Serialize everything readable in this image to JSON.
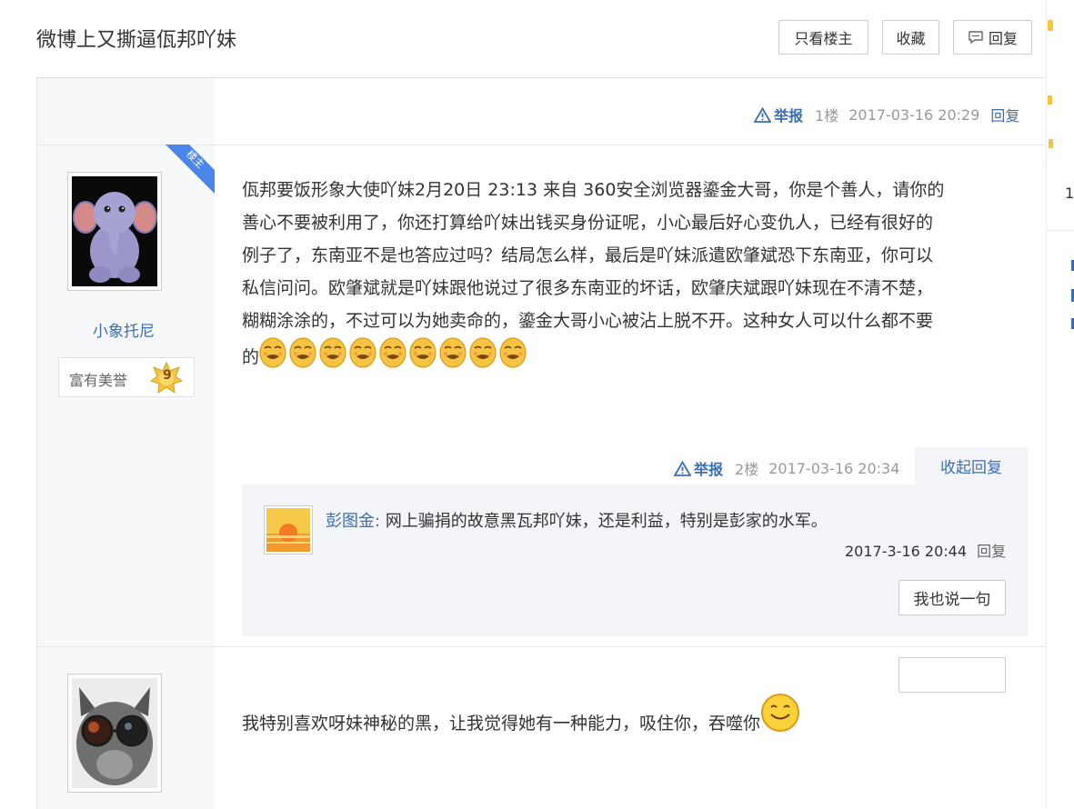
{
  "thread": {
    "title": "微博上又撕逼佤邦吖妹"
  },
  "toolbar": {
    "only_op": "只看楼主",
    "favorite": "收藏",
    "reply": "回复"
  },
  "floor1": {
    "report": "举报",
    "floor": "1楼",
    "time": "2017-03-16 20:29",
    "reply": "回复"
  },
  "post2": {
    "op_badge": "楼主",
    "username": "小象托尼",
    "rank_title": "富有美誉",
    "level": "9",
    "lines": [
      "佤邦要饭形象大使吖妹2月20日 23:13 来自 360安全浏览器鎏金大哥，你是个善人，请你的",
      "善心不要被利用了，你还打算给吖妹出钱买身份证呢，小心最后好心变仇人，已经有很好的",
      "例子了，东南亚不是也答应过吗？结局怎么样，最后是吖妹派遣欧肇斌恐下东南亚，你可以",
      "私信问问。欧肇斌就是吖妹跟他说过了很多东南亚的坏话，欧肇庆斌跟吖妹现在不清不楚，",
      "糊糊涂涂的，不过可以为她卖命的，鎏金大哥小心被沾上脱不开。这种女人可以什么都不要",
      "的"
    ],
    "report": "举报",
    "floor": "2楼",
    "time": "2017-03-16 20:34",
    "collapse": "收起回复"
  },
  "subreply": {
    "user": "彭图金",
    "sep": ":",
    "text": "网上骗捐的故意黑瓦邦吖妹，还是利益，特别是彭家的水军。",
    "time": "2017-3-16 20:44",
    "reply": "回复",
    "say_button": "我也说一句"
  },
  "post3": {
    "text": "我特别喜欢呀妹神秘的黑，让我觉得她有一种能力，吸住你，吞噬你"
  },
  "right_edge": {
    "digit": "1"
  },
  "colors": {
    "link": "#3b6eb4",
    "badge": "#4a86e8",
    "side_bg": "#f7f8fa",
    "reply_bg": "#f3f5f8"
  }
}
